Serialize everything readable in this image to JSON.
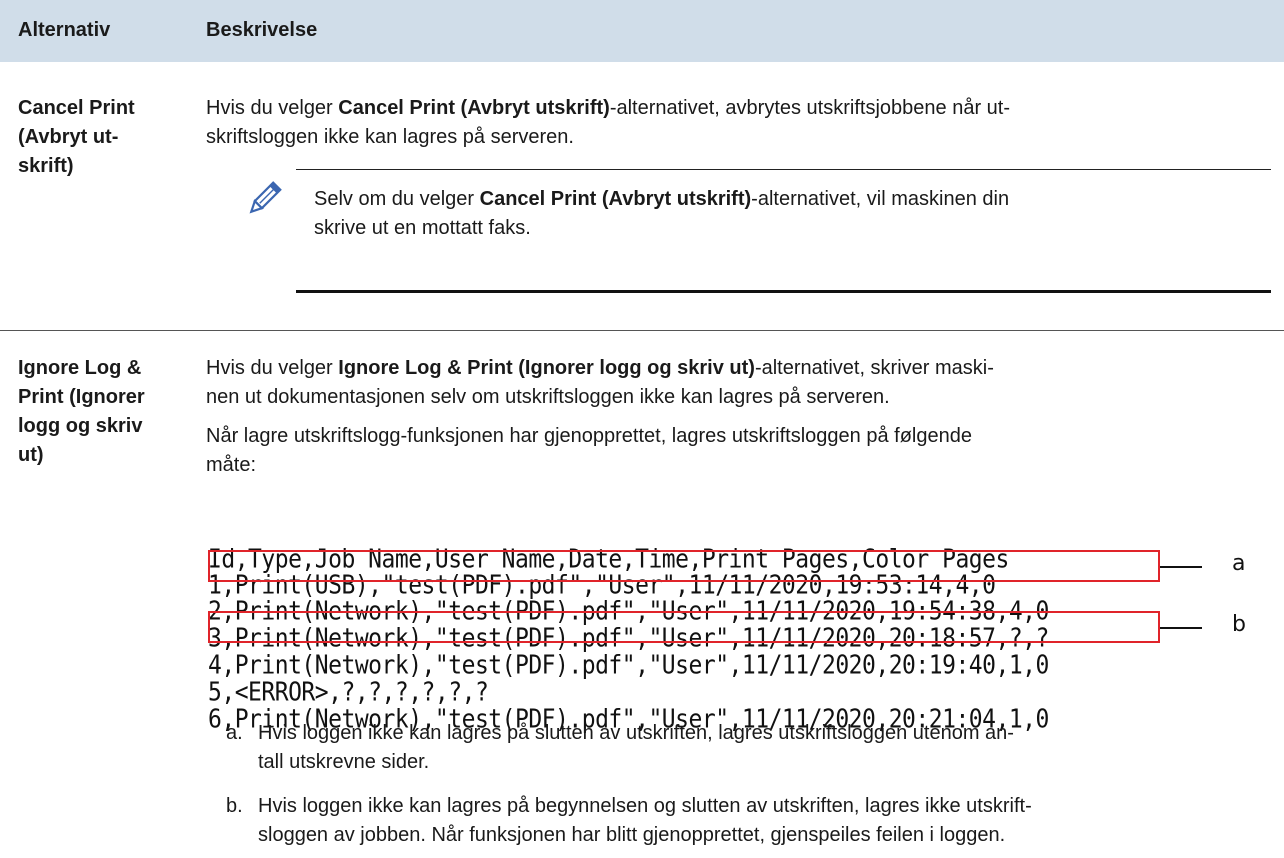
{
  "table": {
    "header": {
      "col1": "Alternativ",
      "col2": "Beskrivelse"
    },
    "row1": {
      "option": [
        "Cancel Print",
        "(Avbryt ut-",
        "skrift)"
      ],
      "desc": {
        "p1": "Hvis du velger",
        "p1_bold": "Cancel Print (Avbryt utskrift)",
        "p1_rest": "-alternativet, avbrytes utskriftsjobbene når ut-",
        "p2": "skriftsloggen ikke kan lagres på serveren."
      },
      "note": {
        "icon": "pencil-note-icon",
        "p1": "Selv om du velger",
        "p1_bold": "Cancel Print (Avbryt utskrift)",
        "p1_rest": "-alternativet, vil maskinen din",
        "p2": "skrive ut en mottatt faks."
      }
    },
    "row2": {
      "option": [
        "Ignore Log &",
        "Print (Ignorer",
        "logg og skriv",
        "ut)"
      ],
      "desc": {
        "p1": "Hvis du velger",
        "p1_bold": "Ignore Log & Print (Ignorer logg og skriv ut)",
        "p1_rest": "-alternativet, skriver maski-",
        "p2": "nen ut dokumentasjonen selv om utskriftsloggen ikke kan lagres på serveren.",
        "p3": "Når lagre utskriftslogg-funksjonen har gjenopprettet, lagres utskriftsloggen på følgende",
        "p4": "måte:"
      },
      "log_lines": [
        "Id,Type,Job Name,User Name,Date,Time,Print Pages,Color Pages",
        "1,Print(USB),\"test(PDF).pdf\",\"User\",11/11/2020,19:53:14,4,0",
        "2,Print(Network),\"test(PDF).pdf\",\"User\",11/11/2020,19:54:38,4,0",
        "3,Print(Network),\"test(PDF).pdf\",\"User\",11/11/2020,20:18:57,?,?",
        "4,Print(Network),\"test(PDF).pdf\",\"User\",11/11/2020,20:19:40,1,0",
        "5,<ERROR>,?,?,?,?,?,?",
        "6,Print(Network),\"test(PDF).pdf\",\"User\",11/11/2020,20:21:04,1,0"
      ],
      "callouts": [
        "a",
        "b"
      ],
      "highlight_color": "#e0242a",
      "items": [
        {
          "label": "a.",
          "l1": "Hvis loggen ikke kan lagres på slutten av utskriften, lagres utskriftsloggen utenom an-",
          "l2": "tall utskrevne sider."
        },
        {
          "label": "b.",
          "l1": "Hvis loggen ikke kan lagres på begynnelsen og slutten av utskriften, lagres ikke utskrift-",
          "l2": "sloggen av jobben. Når funksjonen har blitt gjenopprettet, gjenspeiles feilen i loggen."
        }
      ]
    },
    "header_bg": "#d0dde9"
  }
}
